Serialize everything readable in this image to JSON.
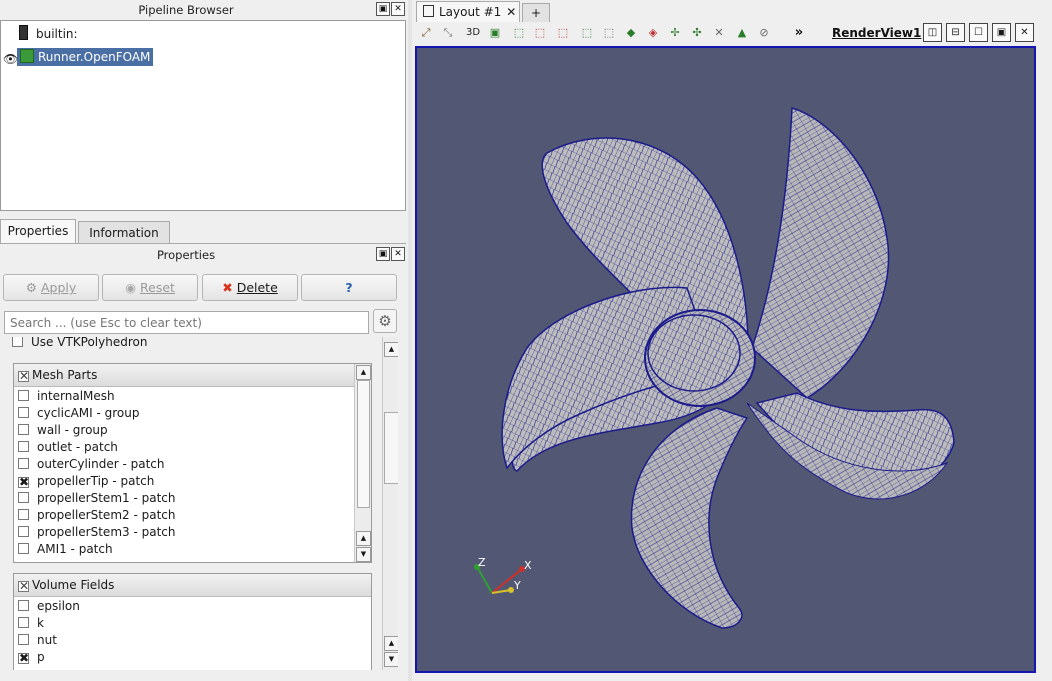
{
  "pipeline_browser": {
    "title": "Pipeline Browser",
    "items": [
      {
        "label": "builtin:",
        "icon": "server-icon"
      },
      {
        "label": "Runner.OpenFOAM",
        "icon": "dataset-icon",
        "visible": true
      }
    ]
  },
  "tabs": {
    "properties": "Properties",
    "information": "Information"
  },
  "properties_panel": {
    "title": "Properties",
    "apply": "Apply",
    "reset": "Reset",
    "delete": "Delete",
    "help": "?",
    "search_placeholder": "Search ... (use Esc to clear text)",
    "use_vtk_polyhedron": "Use VTKPolyhedron"
  },
  "mesh_parts": {
    "header": "Mesh Parts",
    "items": [
      {
        "label": "internalMesh",
        "checked": false
      },
      {
        "label": "cyclicAMI - group",
        "checked": false
      },
      {
        "label": "wall - group",
        "checked": false
      },
      {
        "label": "outlet - patch",
        "checked": false
      },
      {
        "label": "outerCylinder - patch",
        "checked": false
      },
      {
        "label": "propellerTip - patch",
        "checked": true
      },
      {
        "label": "propellerStem1 - patch",
        "checked": false
      },
      {
        "label": "propellerStem2 - patch",
        "checked": false
      },
      {
        "label": "propellerStem3 - patch",
        "checked": false
      },
      {
        "label": "AMI1 - patch",
        "checked": false
      }
    ]
  },
  "volume_fields": {
    "header": "Volume Fields",
    "items": [
      {
        "label": "epsilon",
        "checked": false
      },
      {
        "label": "k",
        "checked": false
      },
      {
        "label": "nut",
        "checked": false
      },
      {
        "label": "p",
        "checked": true
      }
    ]
  },
  "layout": {
    "tab_label": "Layout #1",
    "add_tab": "+",
    "view_name": "RenderView1",
    "mode_3d": "3D",
    "more": "»"
  },
  "axes": {
    "x": "X",
    "y": "Y",
    "z": "Z"
  },
  "colors": {
    "render_background": "#525873",
    "mesh_surface": "#bdbdbd",
    "mesh_edges": "#1b1b8c",
    "selection": "#4a6fa5",
    "active_view_border": "#1515b0"
  }
}
